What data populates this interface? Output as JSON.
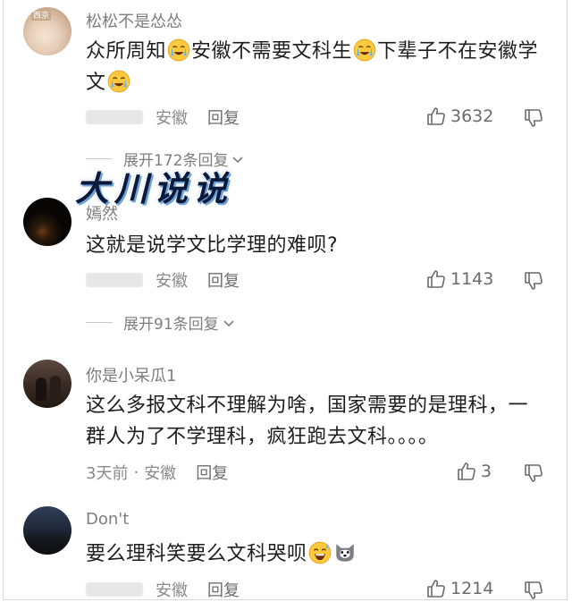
{
  "watermark": "大川说说",
  "comments": [
    {
      "username": "松松不是怂怂",
      "avatar_label": "西京",
      "text_parts": [
        "众所周知",
        "安徽不需要文科生",
        "下辈子不在安徽学文"
      ],
      "time": "",
      "location": "安徽",
      "reply_label": "回复",
      "likes": "3632",
      "expand_label": "展开172条回复"
    },
    {
      "username": "嫣然",
      "text": "这就是说学文比学理的难呗?",
      "time": "",
      "location": "安徽",
      "reply_label": "回复",
      "likes": "1143",
      "expand_label": "展开91条回复"
    },
    {
      "username": "你是小呆瓜1",
      "text": "这么多报文科不理解为啥，国家需要的是理科，一群人为了不学理科，疯狂跑去文科。。。。",
      "time": "3天前",
      "location": "安徽",
      "reply_label": "回复",
      "likes": "3"
    },
    {
      "username": "Don't",
      "text": "要么理科笑要么文科哭呗",
      "time": "",
      "location": "安徽",
      "reply_label": "回复",
      "likes": "1214"
    }
  ],
  "icons": {
    "like": "thumbs-up-icon",
    "dislike": "thumbs-down-icon",
    "expand": "chevron-down-icon",
    "emoji_cry": "crying-face-emoji",
    "emoji_sweat": "laughing-sweat-emoji",
    "emoji_husky": "husky-dog-emoji"
  },
  "colors": {
    "text": "#1e1e1e",
    "meta": "#8a8a8a",
    "watermark": "#0b1a3a"
  }
}
